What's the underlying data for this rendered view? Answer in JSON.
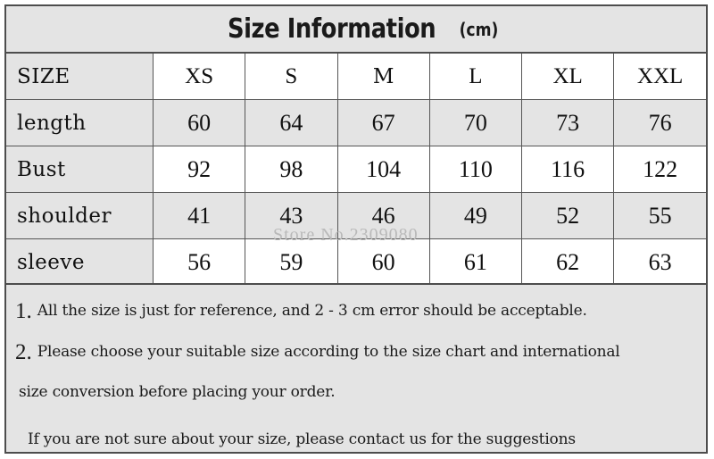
{
  "header": {
    "title": "Size Information",
    "unit": "(cm)"
  },
  "table": {
    "columns": [
      "SIZE",
      "XS",
      "S",
      "M",
      "L",
      "XL",
      "XXL"
    ],
    "rows": [
      {
        "label": "length",
        "values": [
          "60",
          "64",
          "67",
          "70",
          "73",
          "76"
        ]
      },
      {
        "label": "Bust",
        "values": [
          "92",
          "98",
          "104",
          "110",
          "116",
          "122"
        ]
      },
      {
        "label": "shoulder",
        "values": [
          "41",
          "43",
          "46",
          "49",
          "52",
          "55"
        ]
      },
      {
        "label": "sleeve",
        "values": [
          "56",
          "59",
          "60",
          "61",
          "62",
          "63"
        ]
      }
    ]
  },
  "notes": {
    "note1_number": "1.",
    "note1_text": "All the size is just for reference, and 2 - 3 cm error should be acceptable.",
    "note2_number": "2.",
    "note2_text_line1": "Please choose your suitable size according to the size chart and international",
    "note2_text_line2": "size conversion before placing your order.",
    "note3_text": "If you are not sure about your size, please contact us for the suggestions"
  },
  "watermark": {
    "text": "Store No.2309080"
  },
  "colors": {
    "cell_gray": "#e4e4e4",
    "cell_white": "#ffffff",
    "border": "#4d4d4d",
    "text": "#111111",
    "watermark": "#b9b9b9"
  }
}
